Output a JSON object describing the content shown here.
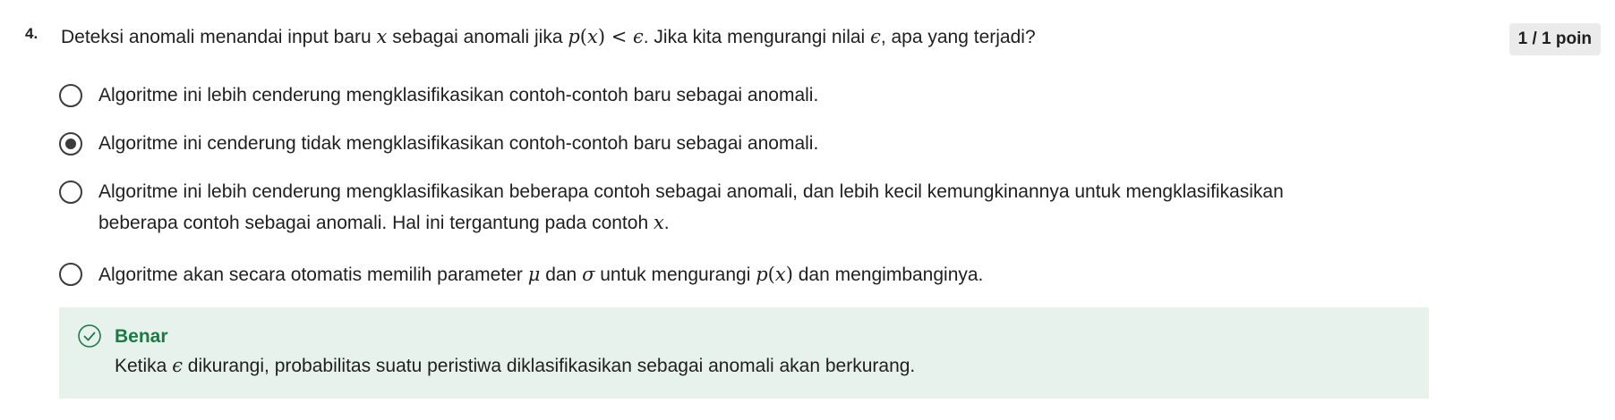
{
  "question": {
    "number": "4.",
    "text_before": "Deteksi anomali menandai input baru ",
    "var_x": "x",
    "text_mid": " sebagai anomali jika ",
    "formula_p": "p",
    "formula_open": "(",
    "formula_x": "x",
    "formula_close": ")",
    "formula_lt": " < ",
    "formula_eps": "ϵ",
    "text_after": ". Jika kita mengurangi nilai ",
    "eps": "ϵ",
    "text_end": ", apa yang terjadi?",
    "points": "1 / 1 poin"
  },
  "options": [
    {
      "text": "Algoritme ini lebih cenderung mengklasifikasikan contoh-contoh baru sebagai anomali.",
      "checked": false
    },
    {
      "text": "Algoritme ini cenderung tidak mengklasifikasikan contoh-contoh baru sebagai anomali.",
      "checked": true
    },
    {
      "text_line1": "Algoritme ini lebih cenderung mengklasifikasikan beberapa contoh sebagai anomali, dan lebih kecil kemungkinannya untuk mengklasifikasikan",
      "text_line2": "beberapa contoh sebagai anomali. Hal ini tergantung pada contoh ",
      "math_x": "x",
      "text_end": ".",
      "checked": false
    },
    {
      "text_before": "Algoritme akan secara otomatis memilih parameter ",
      "mu": "μ",
      "text_and": " dan ",
      "sigma": "σ",
      "text_mid": " untuk mengurangi ",
      "p": "p",
      "open": "(",
      "x": "x",
      "close": ")",
      "text_end": " dan mengimbanginya.",
      "checked": false
    }
  ],
  "feedback": {
    "title": "Benar",
    "text_before": "Ketika ",
    "eps": "ϵ",
    "text_after": " dikurangi, probabilitas suatu peristiwa diklasifikasikan sebagai anomali akan berkurang.",
    "icon": "check-circle-icon",
    "color": "#1c7a45",
    "background": "#e8f2ec"
  }
}
